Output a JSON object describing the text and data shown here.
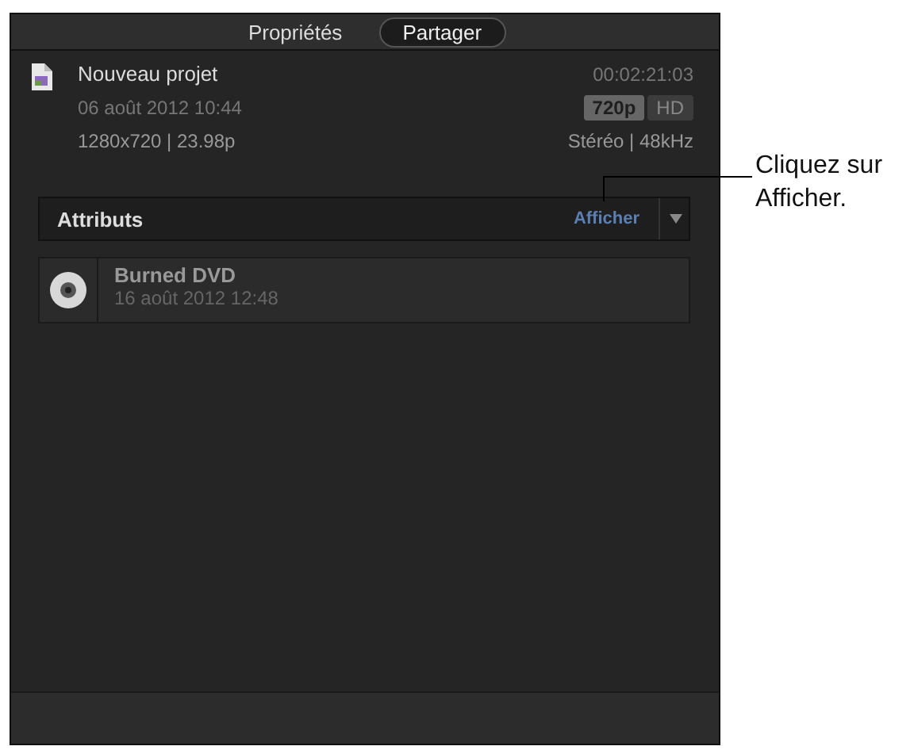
{
  "tabs": [
    {
      "label": "Propriétés",
      "selected": false
    },
    {
      "label": "Partager",
      "selected": true
    }
  ],
  "project": {
    "name": "Nouveau projet",
    "duration": "00:02:21:03",
    "date": "06 août 2012 10:44",
    "format": "720p",
    "quality": "HD",
    "resolution": "1280x720  |  23.98p",
    "audio": "Stéréo  |  48kHz"
  },
  "attributes": {
    "label": "Attributs",
    "action": "Afficher"
  },
  "shares": [
    {
      "title": "Burned DVD",
      "date": "16 août 2012 12:48"
    }
  ],
  "callout": "Cliquez sur Afficher."
}
